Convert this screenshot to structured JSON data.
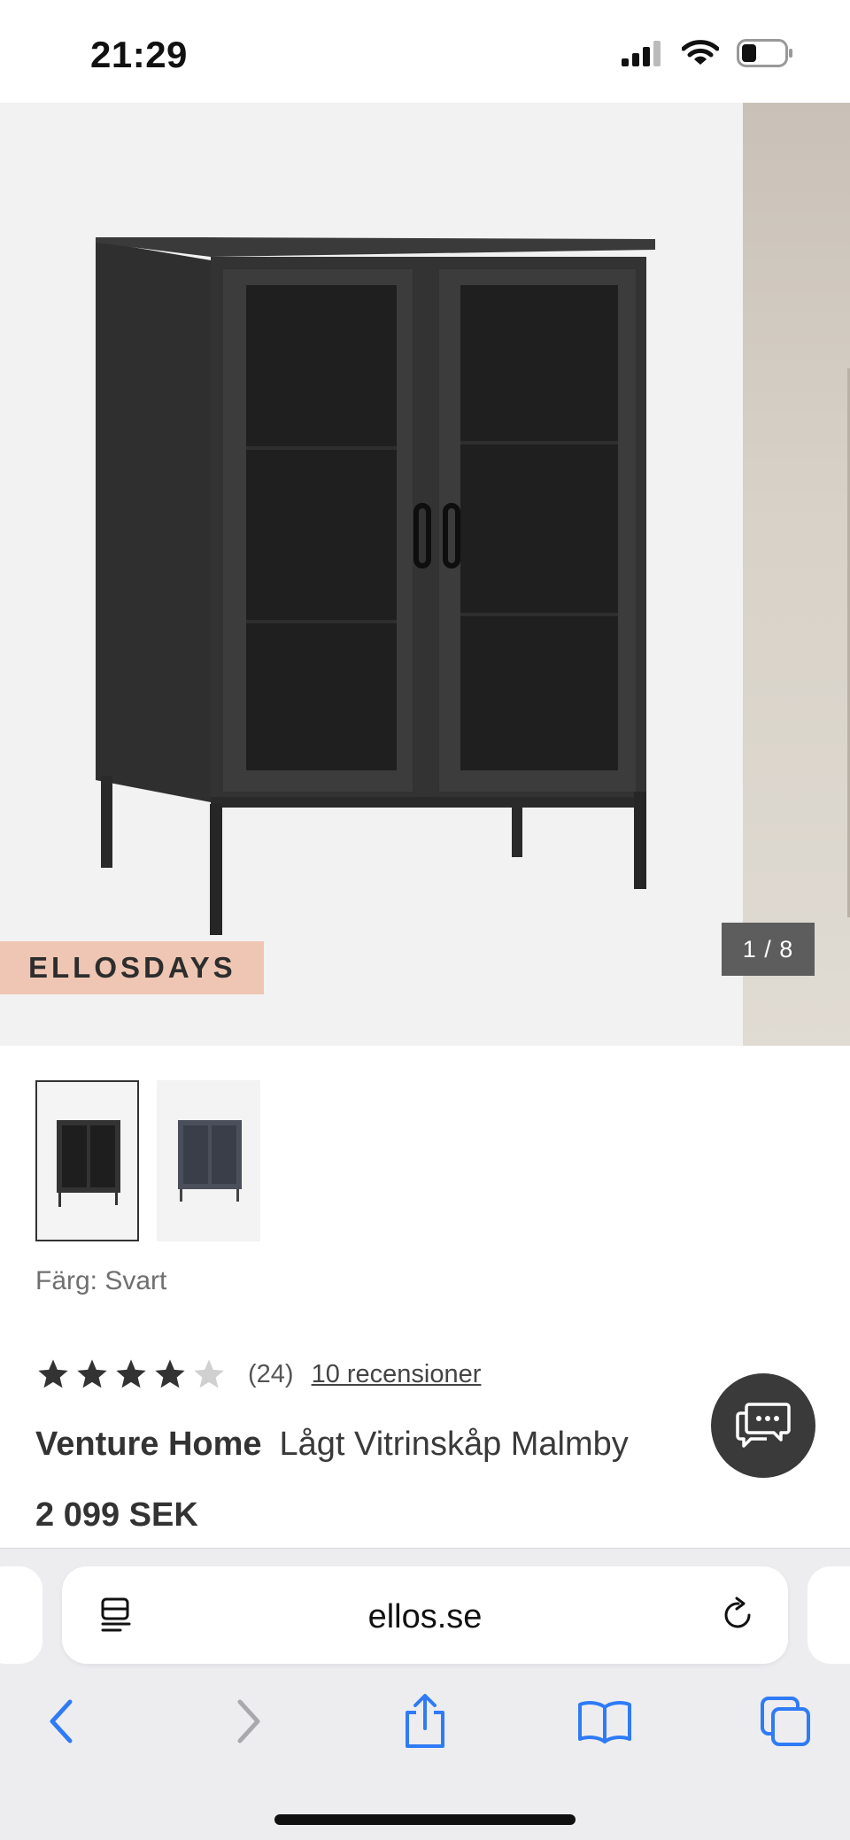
{
  "status_bar": {
    "time": "21:29"
  },
  "gallery": {
    "badge": "ELLOSDAYS",
    "counter": "1 / 8"
  },
  "product": {
    "color_label": "Färg: Svart",
    "rating": 4,
    "rating_count": "(24)",
    "reviews_link": "10 recensioner",
    "brand": "Venture Home",
    "name": "Lågt Vitrinskåp Malmby",
    "price": "2 099 SEK"
  },
  "browser": {
    "url": "ellos.se"
  },
  "colors": {
    "badge_bg": "#efc6b3",
    "accent_blue": "#2f7bf6",
    "fab_bg": "#3a3a3a"
  },
  "icons": [
    "signal-icon",
    "wifi-icon",
    "battery-icon",
    "chat-icon",
    "reader-icon",
    "reload-icon",
    "back-icon",
    "forward-icon",
    "share-icon",
    "bookmarks-icon",
    "tabs-icon"
  ]
}
